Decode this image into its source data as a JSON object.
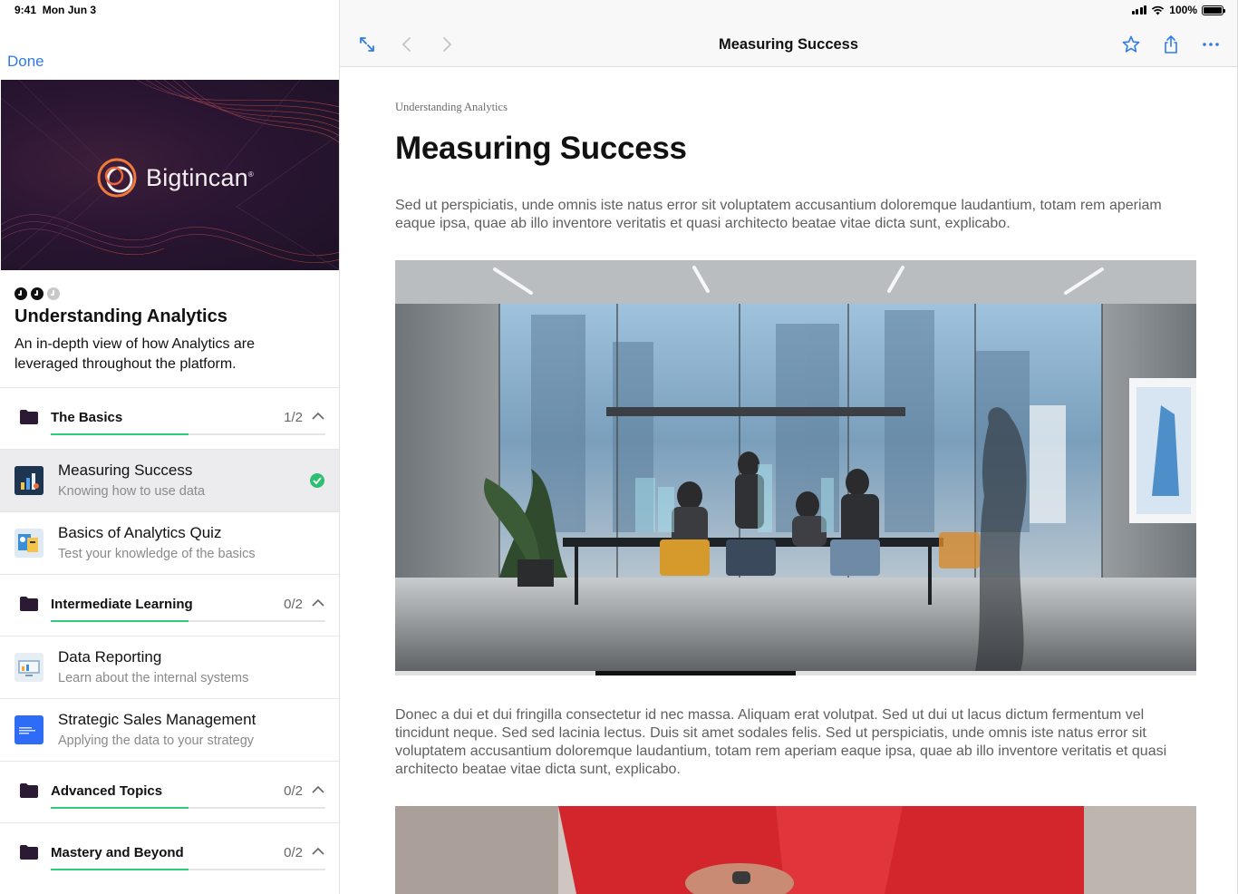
{
  "status": {
    "time": "9:41",
    "date": "Mon Jun 3",
    "battery": "100%",
    "battery_level": 1.0
  },
  "sidebar": {
    "done_label": "Done",
    "hero": {
      "brand": "Bigtincan",
      "trademark": "®"
    },
    "progress": {
      "completed": 2,
      "total": 3
    },
    "course_title": "Understanding Analytics",
    "course_description": "An in-depth view of how Analytics are leveraged throughout the platform.",
    "sections": [
      {
        "name": "The Basics",
        "count": "1/2",
        "progress": 0.5,
        "lessons": [
          {
            "title": "Measuring Success",
            "subtitle": "Knowing how to use data",
            "active": true,
            "complete": true
          },
          {
            "title": "Basics of Analytics Quiz",
            "subtitle": "Test your knowledge of the basics",
            "active": false,
            "complete": false
          }
        ]
      },
      {
        "name": "Intermediate Learning",
        "count": "0/2",
        "progress": 0.5,
        "lessons": [
          {
            "title": "Data Reporting",
            "subtitle": "Learn about the internal systems"
          },
          {
            "title": "Strategic Sales Management",
            "subtitle": "Applying the data to your strategy"
          }
        ]
      },
      {
        "name": "Advanced Topics",
        "count": "0/2",
        "progress": 0.5
      },
      {
        "name": "Mastery and Beyond",
        "count": "0/2",
        "progress": 0.5
      }
    ]
  },
  "main": {
    "nav_title": "Measuring Success",
    "breadcrumb": "Understanding Analytics",
    "title": "Measuring Success",
    "paragraph1": "Sed ut perspiciatis, unde omnis iste natus error sit voluptatem accusantium doloremque laudantium, totam rem aperiam eaque ipsa, quae ab illo inventore veritatis et quasi architecto beatae vitae dicta sunt, explicabo.",
    "paragraph2": "Donec a dui et dui fringilla consectetur id nec massa. Aliquam erat volutpat. Sed ut dui ut lacus dictum fermentum vel tincidunt neque. Sed sed lacinia lectus. Duis sit amet sodales felis. Sed ut perspiciatis, unde omnis iste natus error sit voluptatem accusantium doloremque laudantium, totam rem aperiam eaque ipsa, quae ab illo inventore veritatis et quasi architecto beatae vitae dicta sunt, explicabo.",
    "carousel": {
      "page": 2,
      "pages": 4
    }
  },
  "colors": {
    "accent": "#2f7bea",
    "progress": "#2fcd79",
    "check": "#2fbf71",
    "hero_bg": "#2a1532"
  }
}
